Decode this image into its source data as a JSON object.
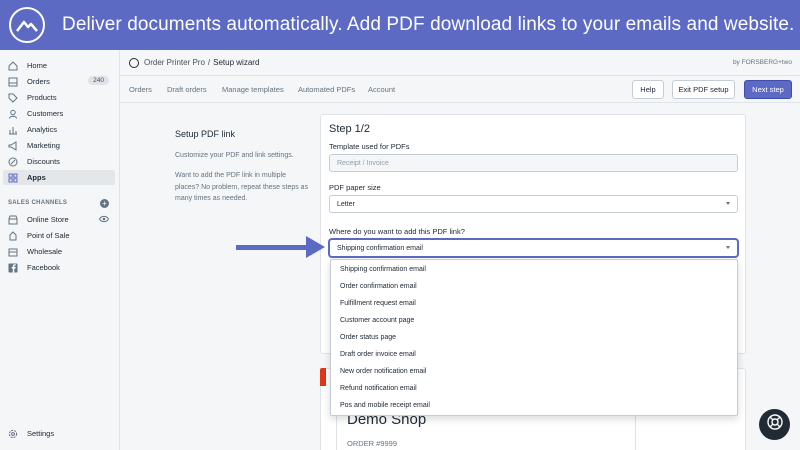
{
  "banner": {
    "text": "Deliver documents automatically. Add PDF download links to your emails and website."
  },
  "sidebar": {
    "items": [
      {
        "label": "Home",
        "icon": "home-icon"
      },
      {
        "label": "Orders",
        "icon": "orders-icon",
        "badge": "240"
      },
      {
        "label": "Products",
        "icon": "tag-icon"
      },
      {
        "label": "Customers",
        "icon": "customer-icon"
      },
      {
        "label": "Analytics",
        "icon": "analytics-icon"
      },
      {
        "label": "Marketing",
        "icon": "megaphone-icon"
      },
      {
        "label": "Discounts",
        "icon": "discount-icon"
      },
      {
        "label": "Apps",
        "icon": "apps-icon",
        "active": true
      }
    ],
    "channels_title": "SALES CHANNELS",
    "channels": [
      {
        "label": "Online Store",
        "icon": "store-icon"
      },
      {
        "label": "Point of Sale",
        "icon": "pos-icon"
      },
      {
        "label": "Wholesale",
        "icon": "wholesale-icon"
      },
      {
        "label": "Facebook",
        "icon": "facebook-icon"
      }
    ],
    "settings_label": "Settings"
  },
  "header": {
    "app_name": "Order Printer Pro",
    "separator": "/",
    "current": "Setup wizard",
    "byline": "by FORSBERG+two"
  },
  "tabs": [
    "Orders",
    "Draft orders",
    "Manage templates",
    "Automated PDFs",
    "Account"
  ],
  "actions": {
    "help": "Help",
    "exit": "Exit PDF setup",
    "next": "Next step"
  },
  "description": {
    "title": "Setup PDF link",
    "p1": "Customize your PDF and link settings.",
    "p2": "Want to add the PDF link in multiple places? No problem, repeat these steps as many times as needed."
  },
  "form": {
    "step": "Step 1/2",
    "template_label": "Template used for PDFs",
    "template_value": "Receipt / Invoice",
    "paper_label": "PDF paper size",
    "paper_value": "Letter",
    "where_label": "Where do you want to add this PDF link?",
    "where_value": "Shipping confirmation email"
  },
  "dropdown": {
    "options": [
      "Shipping confirmation email",
      "Order confirmation email",
      "Fulfillment request email",
      "Customer account page",
      "Order status page",
      "Draft order invoice email",
      "New order notification email",
      "Refund notification email",
      "Pos and mobile receipt email"
    ]
  },
  "preview": {
    "shop_name": "Demo Shop",
    "order_number": "ORDER #9999"
  },
  "colors": {
    "brand": "#5c6ac4",
    "sidebar_bg": "#f4f6f8",
    "text": "#212b36",
    "muted": "#637381"
  }
}
